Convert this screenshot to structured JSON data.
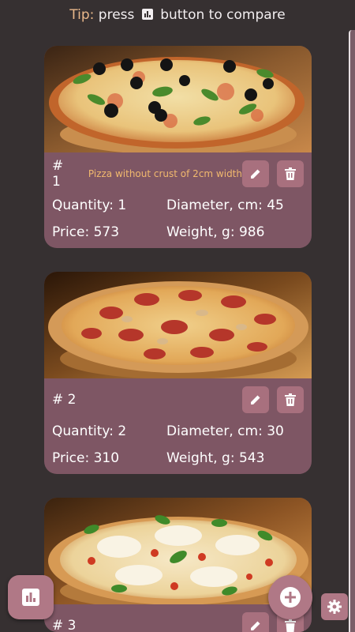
{
  "tip": {
    "label": "Tip:",
    "before": "press",
    "icon": "bar-chart-icon",
    "after": "button to compare"
  },
  "colors": {
    "background": "#363031",
    "card": "#7e5664",
    "button": "#a8707e",
    "accent_text": "#f1b96e",
    "tip_label": "#e9b88a"
  },
  "cards": [
    {
      "number": "# 1",
      "note": "Pizza without crust of 2cm width",
      "quantity": "Quantity: 1",
      "diameter": "Diameter, cm: 45",
      "price": "Price: 573",
      "weight": "Weight, g: 986",
      "photo": "pizza-olives-basil-photo"
    },
    {
      "number": "# 2",
      "note": "",
      "quantity": "Quantity: 2",
      "diameter": "Diameter, cm: 30",
      "price": "Price: 310",
      "weight": "Weight, g: 543",
      "photo": "pizza-pepperoni-photo"
    },
    {
      "number": "# 3",
      "note": "",
      "photo": "pizza-mozzarella-basil-photo"
    }
  ],
  "icons": {
    "edit": "pencil-icon",
    "delete": "trash-icon",
    "compare": "bar-chart-icon",
    "add": "plus-icon",
    "settings": "gear-icon"
  }
}
